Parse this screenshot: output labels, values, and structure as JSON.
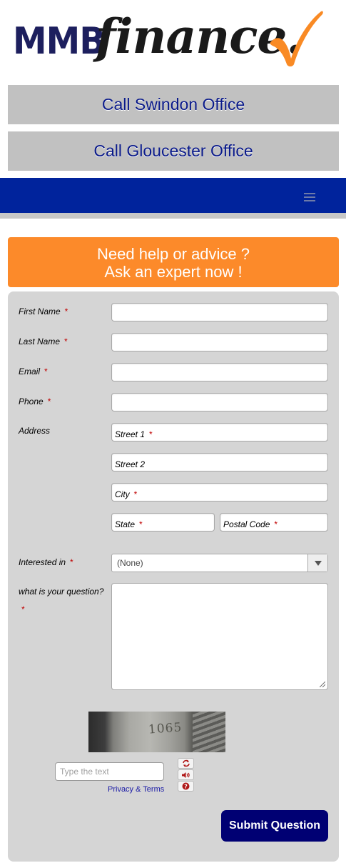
{
  "logo": {
    "mmb": "MMB",
    "finance": "finance.",
    "check_color": "#f98a24"
  },
  "header": {
    "call_swindon": "Call Swindon Office",
    "call_gloucester": "Call Gloucester Office"
  },
  "navbar": {
    "color": "#00239c",
    "menu_icon": "hamburger-icon"
  },
  "banner": {
    "line1": "Need help or advice ?",
    "line2": "Ask an expert now !"
  },
  "form": {
    "required_mark": "*",
    "first_name_label": "First Name",
    "last_name_label": "Last Name",
    "email_label": "Email",
    "phone_label": "Phone",
    "address_label": "Address",
    "street1_label": "Street 1",
    "street2_label": "Street 2",
    "city_label": "City",
    "state_label": "State",
    "postal_label": "Postal Code",
    "interested_label": "Interested in",
    "interested_value": "(None)",
    "question_label": "what is your question?"
  },
  "captcha": {
    "image_text": "1065",
    "placeholder": "Type the text",
    "privacy_link": "Privacy & Terms",
    "refresh_icon": "refresh-icon",
    "audio_icon": "audio-icon",
    "help_icon": "help-icon"
  },
  "submit": {
    "label": "Submit Question"
  }
}
